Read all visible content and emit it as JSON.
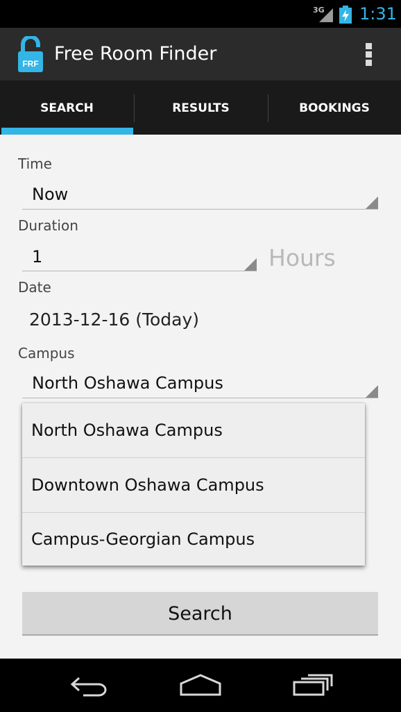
{
  "status_bar": {
    "network": "3G",
    "time": "1:31"
  },
  "action_bar": {
    "icon_text": "FRF",
    "title": "Free Room Finder"
  },
  "tabs": [
    {
      "label": "SEARCH",
      "selected": true
    },
    {
      "label": "RESULTS",
      "selected": false
    },
    {
      "label": "BOOKINGS",
      "selected": false
    }
  ],
  "form": {
    "time_label": "Time",
    "time_value": "Now",
    "duration_label": "Duration",
    "duration_value": "1",
    "duration_unit": "Hours",
    "date_label": "Date",
    "date_value": "2013-12-16 (Today)",
    "campus_label": "Campus",
    "campus_value": "North Oshawa Campus"
  },
  "campus_options": [
    "North Oshawa Campus",
    "Downtown Oshawa Campus",
    "Campus-Georgian Campus"
  ],
  "search_button": "Search",
  "colors": {
    "accent": "#33b5e5",
    "action_bar": "#2b2b2b",
    "tab_bar": "#1a1a1a",
    "content_bg": "#f3f3f3"
  },
  "nav_icons": [
    "back-icon",
    "home-icon",
    "recent-apps-icon"
  ]
}
